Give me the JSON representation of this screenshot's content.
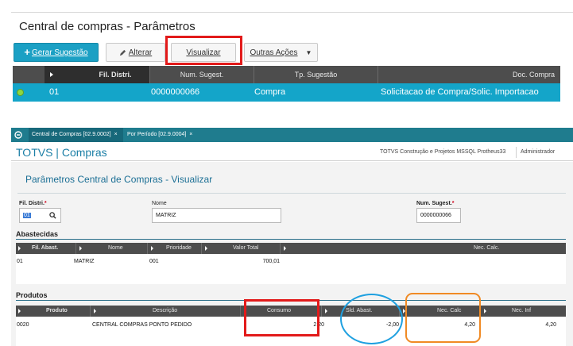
{
  "top": {
    "title": "Central de compras - Parâmetros",
    "buttons": {
      "gerar": "Gerar Sugestão",
      "alterar": "Alterar",
      "visualizar": "Visualizar",
      "outras": "Outras Ações"
    },
    "grid": {
      "headers": [
        "Fil. Distri.",
        "Num. Sugest.",
        "Tp. Sugestão",
        "Doc. Compra"
      ],
      "row": {
        "fil": "01",
        "num": "0000000066",
        "tp": "Compra",
        "doc": "Solicitacao de Compra/Solic. Importacao",
        "status_color": "#8cd642"
      }
    }
  },
  "tabs": [
    {
      "label": "Central de Compras [02.9.0002]",
      "close": "×"
    },
    {
      "label": "Por Período [02.9.0004]",
      "close": "×"
    }
  ],
  "brand": {
    "title": "TOTVS | Compras",
    "env": "TOTVS Construção e Projetos MSSQL Protheus33",
    "user": "Administrador"
  },
  "form": {
    "heading": "Parâmetros Central de Compras - Visualizar",
    "fil_label": "Fil. Distri.",
    "fil_value": "01",
    "nome_label": "Nome",
    "nome_value": "MATRIZ",
    "num_label": "Num. Sugest.",
    "num_value": "0000000066",
    "required_mark": "*"
  },
  "abastecidas": {
    "title": "Abastecidas",
    "headers": [
      "Fil. Abast.",
      "Nome",
      "Prioridade",
      "Valor Total",
      "Nec. Calc."
    ],
    "row": {
      "fil": "01",
      "nome": "MATRIZ",
      "prioridade": "001",
      "valor": "700,01"
    }
  },
  "produtos": {
    "title": "Produtos",
    "headers": [
      "Produto",
      "Descrição",
      "Consumo",
      "Sld. Abast.",
      "Nec. Calc",
      "Nec. Inf"
    ],
    "row": {
      "produto": "0020",
      "descricao": "CENTRAL  COMPRAS PONTO PEDIDO",
      "consumo": "2,20",
      "sld": "-2,00",
      "nec_calc": "4,20",
      "nec_inf": "4,20"
    }
  },
  "colors": {
    "primary": "#1ba0c4",
    "grid_header": "#4d4d4d",
    "selected_row": "#14a5c9",
    "tabbar": "#1f7c8e",
    "brand_text": "#1b7fa6",
    "annotation_red": "#e21a1a",
    "annotation_blue": "#1ea0e0",
    "annotation_orange": "#f08a24"
  }
}
